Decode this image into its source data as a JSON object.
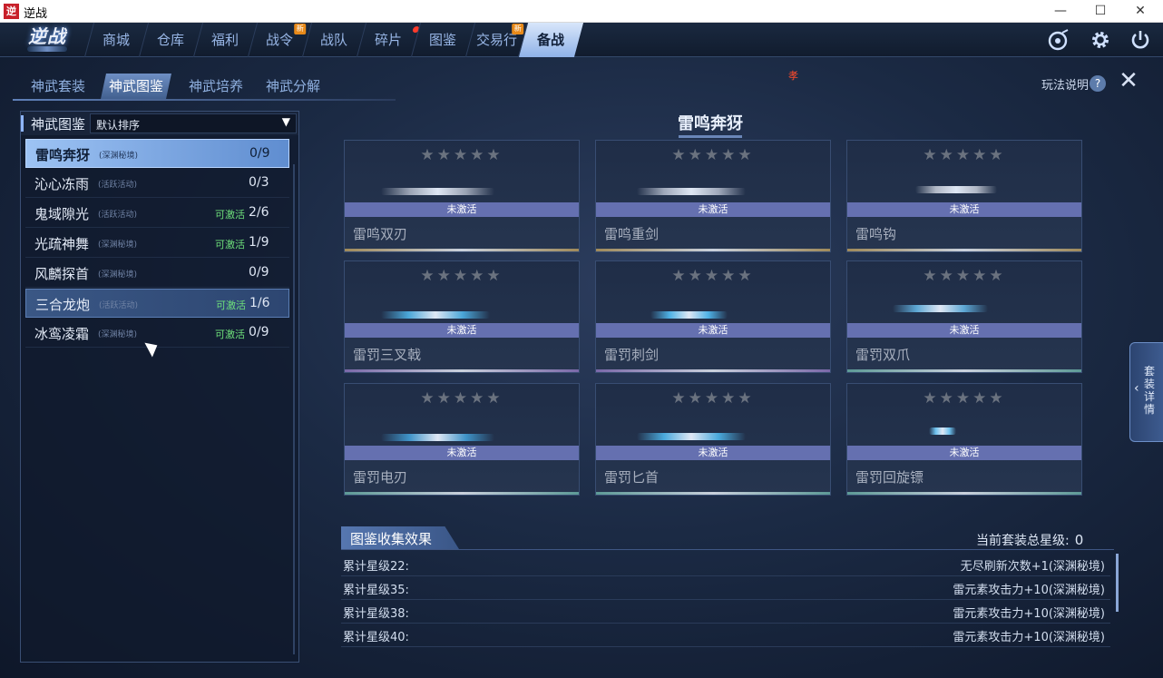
{
  "window": {
    "title": "逆战",
    "icon_glyph": "逆",
    "min_glyph": "—",
    "max_glyph": "☐",
    "close_glyph": "✕"
  },
  "topnav": {
    "logo": "逆战",
    "items": [
      {
        "label": "商城"
      },
      {
        "label": "仓库"
      },
      {
        "label": "福利"
      },
      {
        "label": "战令",
        "badge": "新"
      },
      {
        "label": "战队"
      },
      {
        "label": "碎片",
        "dot": true
      },
      {
        "label": "图鉴"
      },
      {
        "label": "交易行",
        "badge": "新"
      },
      {
        "label": "备战",
        "active": true
      }
    ],
    "icons": [
      "disc-icon",
      "gear-icon",
      "power-icon"
    ]
  },
  "subtabs": {
    "items": [
      "神武套装",
      "神武图鉴",
      "神武培养",
      "神武分解"
    ],
    "active_index": 1,
    "help_label": "玩法说明",
    "help_glyph": "?",
    "close_glyph": "✕",
    "marker": "孝"
  },
  "left_panel": {
    "header_label": "神武图鉴",
    "sort_value": "默认排序",
    "sort_caret": "▼",
    "sets": [
      {
        "name": "雷鸣奔犽",
        "tag": "(深渊秘境)",
        "activatable": "",
        "count": "0/9",
        "state": "selected"
      },
      {
        "name": "沁心冻雨",
        "tag": "(活跃活动)",
        "activatable": "",
        "count": "0/3",
        "state": ""
      },
      {
        "name": "鬼域隙光",
        "tag": "(活跃活动)",
        "activatable": "可激活",
        "count": "2/6",
        "state": ""
      },
      {
        "name": "光疏神舞",
        "tag": "(深渊秘境)",
        "activatable": "可激活",
        "count": "1/9",
        "state": ""
      },
      {
        "name": "风麟探首",
        "tag": "(深渊秘境)",
        "activatable": "",
        "count": "0/9",
        "state": ""
      },
      {
        "name": "三合龙炮",
        "tag": "(活跃活动)",
        "activatable": "可激活",
        "count": "1/6",
        "state": "hover"
      },
      {
        "name": "冰鸾凌霜",
        "tag": "(深渊秘境)",
        "activatable": "可激活",
        "count": "0/9",
        "state": ""
      }
    ]
  },
  "set_title": "雷鸣奔犽",
  "cards": {
    "stars": "★★★★★",
    "inactive_label": "未激活",
    "items": [
      {
        "name": "雷鸣双刃",
        "weapon_color": "#9aa3b4",
        "base_color": "#a08a5a"
      },
      {
        "name": "雷鸣重剑",
        "weapon_color": "#a0a9bb",
        "base_color": "#a08a5a"
      },
      {
        "name": "雷鸣钩",
        "weapon_color": "#b1b8c6",
        "base_color": "#a08a5a"
      },
      {
        "name": "雷罚三叉戟",
        "weapon_color": "#4aa6d8",
        "base_color": "#7a68a8"
      },
      {
        "name": "雷罚刺剑",
        "weapon_color": "#4fb2e6",
        "base_color": "#7a68a8"
      },
      {
        "name": "雷罚双爪",
        "weapon_color": "#5da7d4",
        "base_color": "#5d9a96"
      },
      {
        "name": "雷罚电刃",
        "weapon_color": "#3f93c8",
        "base_color": "#5d9a96"
      },
      {
        "name": "雷罚匕首",
        "weapon_color": "#4aa9dc",
        "base_color": "#5d9a96"
      },
      {
        "name": "雷罚回旋镖",
        "weapon_color": "#6ec3f0",
        "base_color": "#5d9a96"
      }
    ]
  },
  "drawer": {
    "label": "套装详情",
    "arrow": "‹"
  },
  "collection": {
    "title": "图鉴收集效果",
    "total_label": "当前套装总星级:",
    "total_value": "0",
    "effects": [
      {
        "key": "累计星级22:",
        "value": "无尽刷新次数+1(深渊秘境)"
      },
      {
        "key": "累计星级35:",
        "value": "雷元素攻击力+10(深渊秘境)"
      },
      {
        "key": "累计星级38:",
        "value": "雷元素攻击力+10(深渊秘境)"
      },
      {
        "key": "累计星级40:",
        "value": "雷元素攻击力+10(深渊秘境)"
      }
    ]
  }
}
